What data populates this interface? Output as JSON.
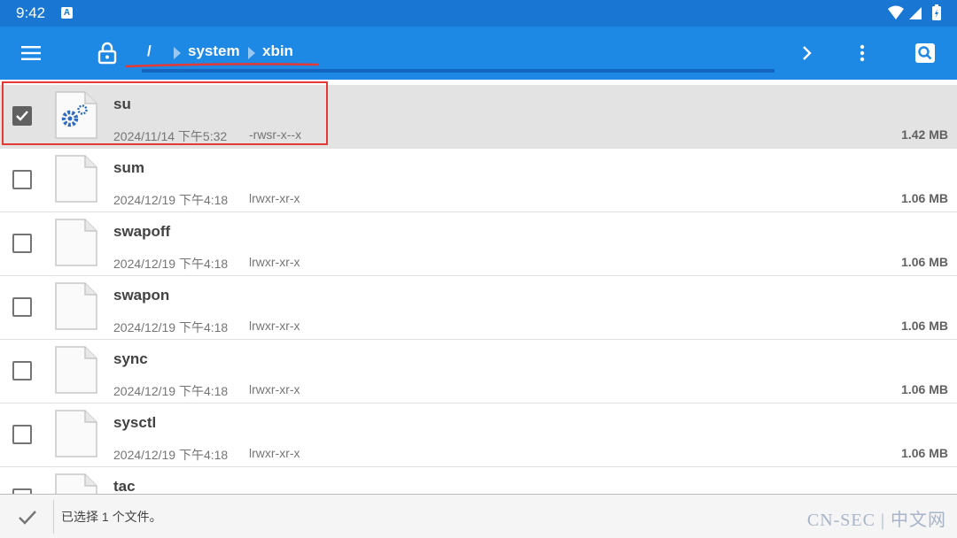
{
  "status": {
    "time": "9:42",
    "notification_letter": "A"
  },
  "toolbar": {
    "menu_icon": "hamburger-menu-icon",
    "lock_icon": "lock-icon",
    "breadcrumbs": [
      "/",
      "system",
      "xbin"
    ],
    "forward_icon": "chevron-right-icon",
    "more_icon": "more-vert-icon",
    "search_icon": "search-icon"
  },
  "files": [
    {
      "name": "su",
      "date": "2024/11/14 下午5:32",
      "perm": "-rwsr-x--x",
      "size": "1.42 MB",
      "checked": true,
      "icon": "settings-file-icon"
    },
    {
      "name": "sum",
      "date": "2024/12/19 下午4:18",
      "perm": "lrwxr-xr-x",
      "size": "1.06 MB",
      "checked": false,
      "icon": "blank-file-icon"
    },
    {
      "name": "swapoff",
      "date": "2024/12/19 下午4:18",
      "perm": "lrwxr-xr-x",
      "size": "1.06 MB",
      "checked": false,
      "icon": "blank-file-icon"
    },
    {
      "name": "swapon",
      "date": "2024/12/19 下午4:18",
      "perm": "lrwxr-xr-x",
      "size": "1.06 MB",
      "checked": false,
      "icon": "blank-file-icon"
    },
    {
      "name": "sync",
      "date": "2024/12/19 下午4:18",
      "perm": "lrwxr-xr-x",
      "size": "1.06 MB",
      "checked": false,
      "icon": "blank-file-icon"
    },
    {
      "name": "sysctl",
      "date": "2024/12/19 下午4:18",
      "perm": "lrwxr-xr-x",
      "size": "1.06 MB",
      "checked": false,
      "icon": "blank-file-icon"
    },
    {
      "name": "tac",
      "date": "",
      "perm": "",
      "size": "",
      "checked": false,
      "icon": "blank-file-icon"
    }
  ],
  "bottom": {
    "selection_text": "已选择 1 个文件。",
    "watermark": "CN-SEC | 中文网"
  },
  "colors": {
    "statusbar": "#1976d2",
    "toolbar": "#1e88e5",
    "highlight_box": "#e53935"
  }
}
